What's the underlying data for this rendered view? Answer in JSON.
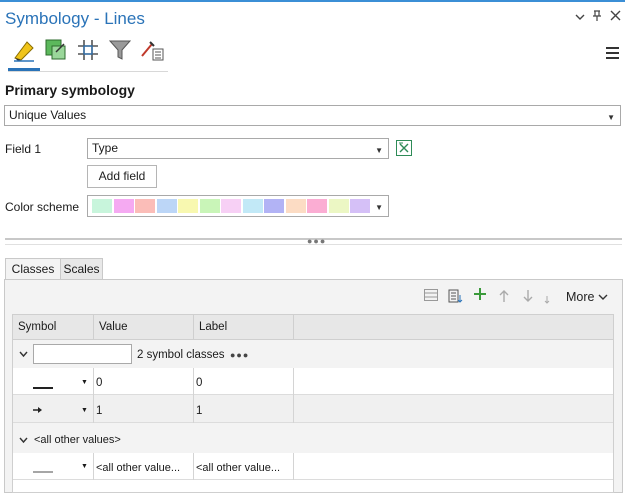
{
  "window": {
    "title": "Symbology - Lines",
    "buttons": {
      "menu": "⌄",
      "pin": "📌",
      "close": "✕"
    }
  },
  "toolbar": {
    "icons": [
      "primary-symbology-icon",
      "vary-symbology-icon",
      "symbol-layer-drawing-icon",
      "label-classes-icon",
      "attribute-driven-icon"
    ]
  },
  "primary": {
    "title": "Primary symbology",
    "method": "Unique Values",
    "field1_label": "Field 1",
    "field1_value": "Type",
    "add_field": "Add field",
    "color_scheme_label": "Color scheme",
    "color_scheme": [
      "#c8f5dc",
      "#f5aaf2",
      "#fbbdb8",
      "#bcd6f7",
      "#f8f8b0",
      "#c9f5b8",
      "#f7d0f5",
      "#c2e9f7",
      "#b2b3f5",
      "#fcdcc4",
      "#fbadd3",
      "#ecf7c4",
      "#d5c0f7"
    ]
  },
  "tabs": {
    "classes": "Classes",
    "scales": "Scales"
  },
  "classes_toolbar": {
    "more": "More"
  },
  "grid": {
    "headers": {
      "symbol": "Symbol",
      "value": "Value",
      "label": "Label"
    },
    "group_count": "2 symbol classes",
    "group_ellipsis": "●●●",
    "rows": [
      {
        "value": "0",
        "label": "0"
      },
      {
        "value": "1",
        "label": "1"
      }
    ],
    "other_header": "<all other values>",
    "other_row": {
      "value": "<all other value...",
      "label": "<all other value..."
    }
  }
}
